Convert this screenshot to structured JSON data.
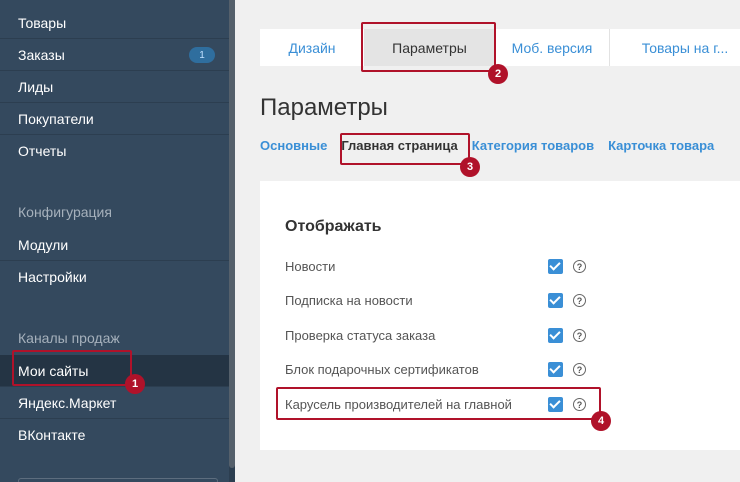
{
  "sidebar": {
    "items": [
      {
        "label": "Товары"
      },
      {
        "label": "Заказы",
        "badge": "1"
      },
      {
        "label": "Лиды"
      },
      {
        "label": "Покупатели"
      },
      {
        "label": "Отчеты"
      }
    ],
    "config_section": "Конфигурация",
    "config_items": [
      {
        "label": "Модули"
      },
      {
        "label": "Настройки"
      }
    ],
    "sales_section": "Каналы продаж",
    "sales_items": [
      {
        "label": "Мои сайты"
      },
      {
        "label": "Яндекс.Маркет"
      },
      {
        "label": "ВКонтакте"
      }
    ]
  },
  "tabs": [
    "Дизайн",
    "Параметры",
    "Моб. версия",
    "Товары на г..."
  ],
  "active_tab": "Параметры",
  "page_title": "Параметры",
  "subtabs": [
    "Основные",
    "Главная страница",
    "Категория товаров",
    "Карточка товара"
  ],
  "active_subtab": "Главная страница",
  "section": {
    "title": "Отображать",
    "options": [
      {
        "label": "Новости",
        "checked": true
      },
      {
        "label": "Подписка на новости",
        "checked": true
      },
      {
        "label": "Проверка статуса заказа",
        "checked": true
      },
      {
        "label": "Блок подарочных сертификатов",
        "checked": true
      },
      {
        "label": "Карусель производителей на главной",
        "checked": true
      }
    ],
    "help_glyph": "?"
  },
  "callouts": [
    "1",
    "2",
    "3",
    "4"
  ],
  "colors": {
    "accent": "#3a8fd6",
    "sidebar": "#34495e",
    "callout": "#b0122a"
  }
}
